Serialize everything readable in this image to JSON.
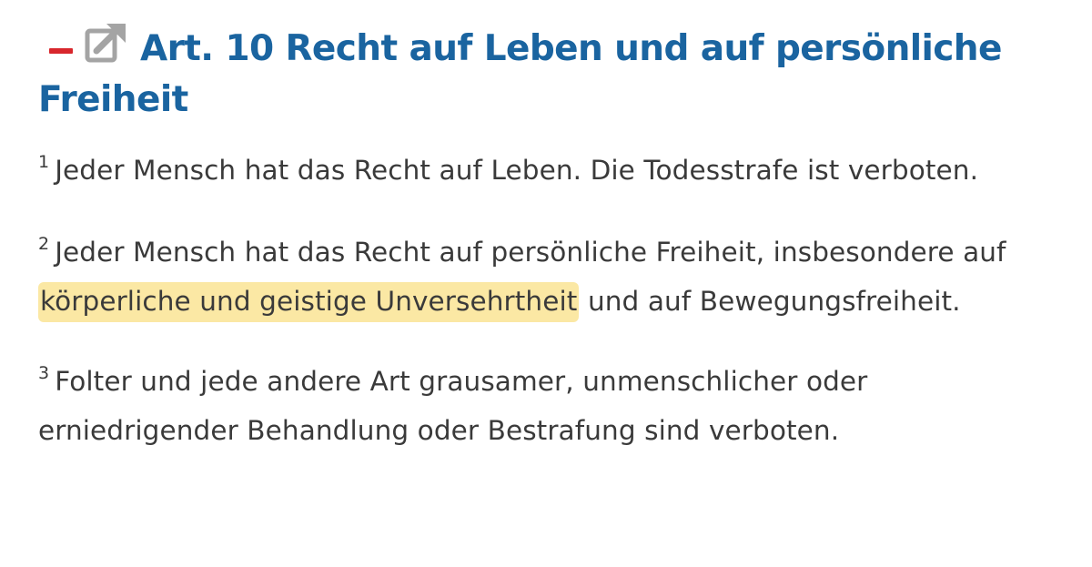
{
  "article": {
    "title": "Art. 10 Recht auf Leben und auf persönliche Freiheit",
    "icons": {
      "collapse": "collapse-minus-icon",
      "external": "external-link-icon"
    },
    "colors": {
      "heading": "#1a64a0",
      "collapse": "#d8262c",
      "body_text": "#3a3a3a",
      "highlight": "#fbe8a4"
    },
    "paragraphs": [
      {
        "num": "1",
        "text": "Jeder Mensch hat das Recht auf Leben. Die Todesstrafe ist verboten."
      },
      {
        "num": "2",
        "text_before": "Jeder Mensch hat das Recht auf persönliche Freiheit, insbesondere auf",
        "highlight": "körperliche und geistige Unversehrtheit",
        "text_after": "und auf Bewegungsfreiheit."
      },
      {
        "num": "3",
        "text": "Folter und jede andere Art grausamer, unmenschlicher oder erniedrigender Behandlung oder Bestrafung sind verboten."
      }
    ]
  }
}
